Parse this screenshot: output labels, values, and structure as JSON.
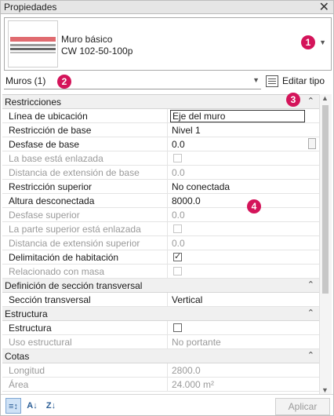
{
  "window": {
    "title": "Propiedades",
    "close_icon": "close-icon"
  },
  "type_selector": {
    "line1": "Muro básico",
    "line2": "CW 102-50-100p"
  },
  "instance": {
    "label": "Muros (1)",
    "edit_type": "Editar tipo"
  },
  "badges": [
    "1",
    "2",
    "3",
    "4"
  ],
  "sections": [
    {
      "name": "Restricciones",
      "rows": [
        {
          "name": "Línea de ubicación",
          "value": "Eje del muro",
          "kind": "edit"
        },
        {
          "name": "Restricción de base",
          "value": "Nivel 1",
          "kind": "text"
        },
        {
          "name": "Desfase de base",
          "value": "0.0",
          "kind": "text"
        },
        {
          "name": "La base está enlazada",
          "value": "",
          "kind": "check",
          "disabled": true
        },
        {
          "name": "Distancia de extensión de base",
          "value": "0.0",
          "kind": "text",
          "disabled": true
        },
        {
          "name": "Restricción superior",
          "value": "No conectada",
          "kind": "text"
        },
        {
          "name": "Altura desconectada",
          "value": "8000.0",
          "kind": "text"
        },
        {
          "name": "Desfase superior",
          "value": "0.0",
          "kind": "text",
          "disabled": true
        },
        {
          "name": "La parte superior está enlazada",
          "value": "",
          "kind": "check",
          "disabled": true
        },
        {
          "name": "Distancia de extensión superior",
          "value": "0.0",
          "kind": "text",
          "disabled": true
        },
        {
          "name": "Delimitación de habitación",
          "value": "",
          "kind": "check",
          "checked": true
        },
        {
          "name": "Relacionado con masa",
          "value": "",
          "kind": "check",
          "disabled": true
        }
      ]
    },
    {
      "name": "Definición de sección transversal",
      "rows": [
        {
          "name": "Sección transversal",
          "value": "Vertical",
          "kind": "text"
        }
      ]
    },
    {
      "name": "Estructura",
      "rows": [
        {
          "name": "Estructura",
          "value": "",
          "kind": "check"
        },
        {
          "name": "Uso estructural",
          "value": "No portante",
          "kind": "text",
          "disabled": true
        }
      ]
    },
    {
      "name": "Cotas",
      "rows": [
        {
          "name": "Longitud",
          "value": "2800.0",
          "kind": "text",
          "disabled": true
        },
        {
          "name": "Área",
          "value": "24.000 m²",
          "kind": "text",
          "disabled": true
        }
      ]
    }
  ],
  "toolbar": {
    "apply_label": "Aplicar"
  },
  "colors": {
    "badge": "#d4145a",
    "wall_layer": "#e06b70"
  }
}
